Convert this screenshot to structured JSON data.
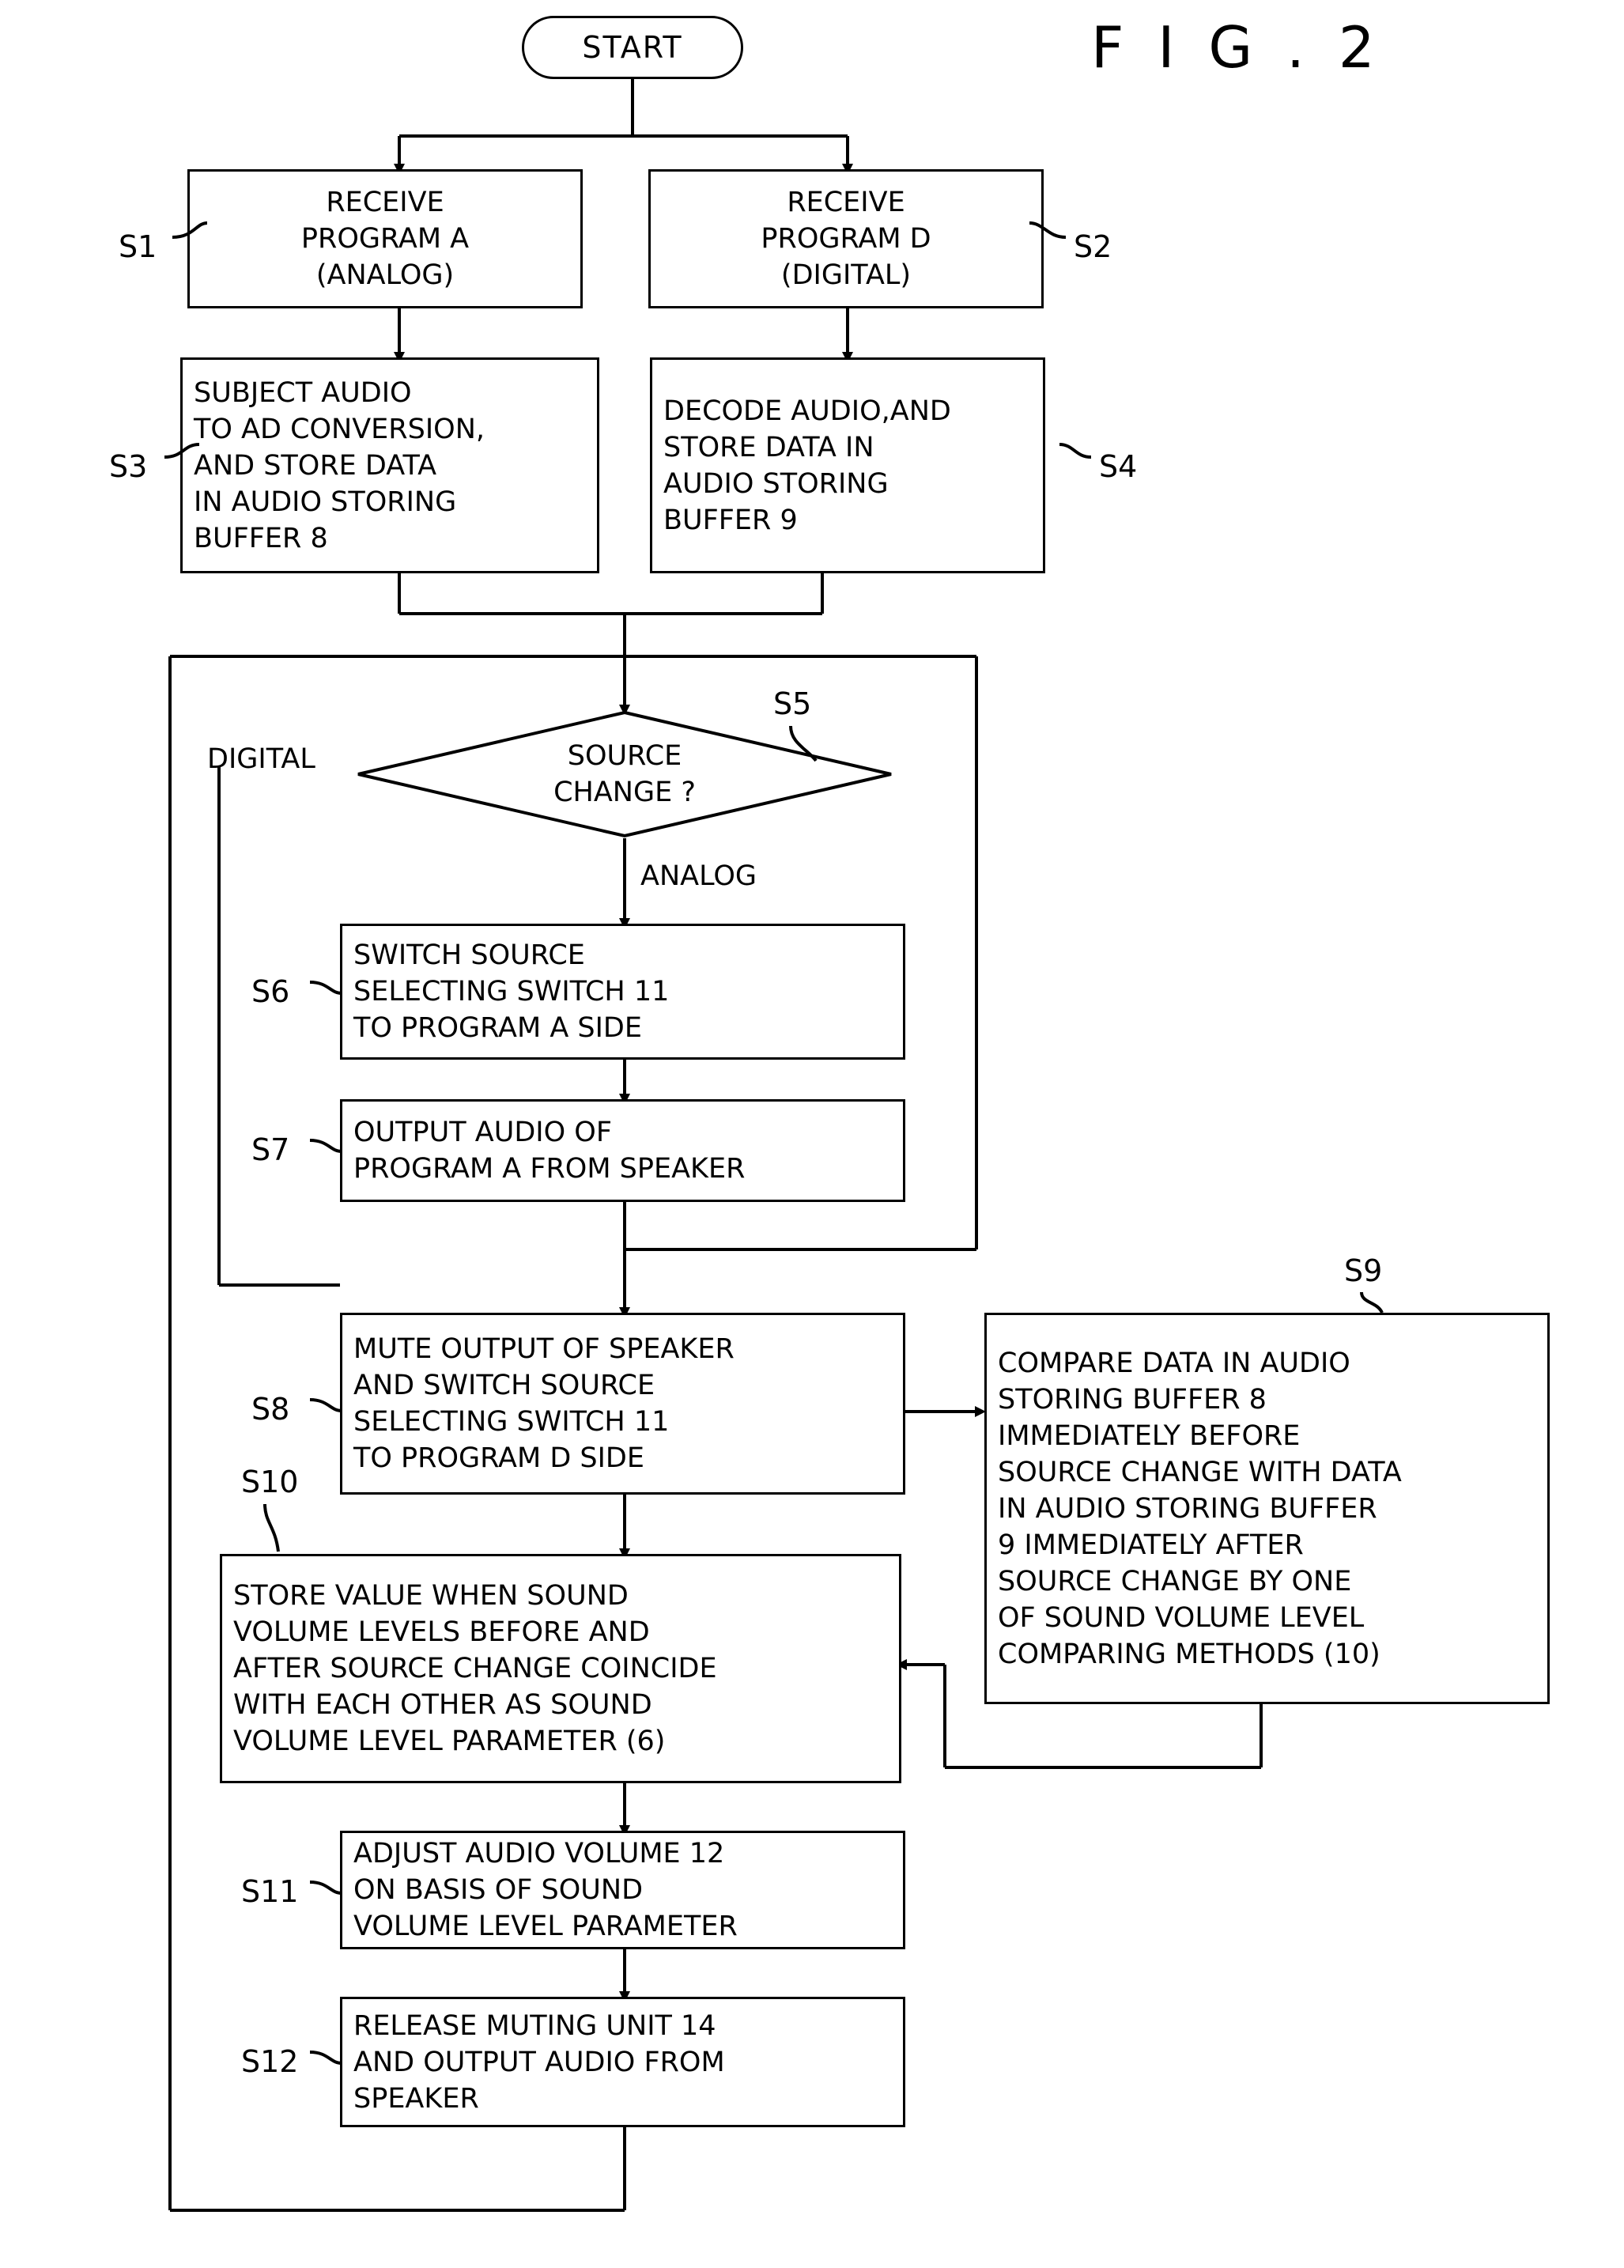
{
  "figure": {
    "title": "F I G . 2"
  },
  "nodes": {
    "start": {
      "label": "START"
    },
    "s1": {
      "tag": "S1",
      "lines": [
        "RECEIVE",
        "PROGRAM A",
        "(ANALOG)"
      ]
    },
    "s2": {
      "tag": "S2",
      "lines": [
        "RECEIVE",
        "PROGRAM D",
        "(DIGITAL)"
      ]
    },
    "s3": {
      "tag": "S3",
      "lines": [
        "SUBJECT AUDIO",
        "TO AD CONVERSION,",
        "AND STORE DATA",
        "IN AUDIO STORING",
        "BUFFER 8"
      ]
    },
    "s4": {
      "tag": "S4",
      "lines": [
        "DECODE AUDIO,AND",
        "STORE DATA IN",
        "AUDIO STORING",
        "BUFFER 9"
      ]
    },
    "s5": {
      "tag": "S5",
      "lines": [
        "SOURCE",
        "CHANGE ?"
      ],
      "branch_left": "DIGITAL",
      "branch_down": "ANALOG"
    },
    "s6": {
      "tag": "S6",
      "lines": [
        "SWITCH SOURCE",
        "SELECTING SWITCH 11",
        "TO PROGRAM A SIDE"
      ]
    },
    "s7": {
      "tag": "S7",
      "lines": [
        "OUTPUT AUDIO OF",
        "PROGRAM A FROM SPEAKER"
      ]
    },
    "s8": {
      "tag": "S8",
      "lines": [
        "MUTE OUTPUT OF SPEAKER",
        "AND SWITCH SOURCE",
        "SELECTING SWITCH 11",
        "TO PROGRAM D SIDE"
      ]
    },
    "s9": {
      "tag": "S9",
      "lines": [
        "COMPARE DATA IN AUDIO",
        "STORING BUFFER 8",
        "IMMEDIATELY BEFORE",
        "SOURCE CHANGE WITH DATA",
        "IN AUDIO STORING BUFFER",
        "9 IMMEDIATELY AFTER",
        "SOURCE CHANGE BY ONE",
        "OF SOUND VOLUME LEVEL",
        "COMPARING METHODS (10)"
      ]
    },
    "s10": {
      "tag": "S10",
      "lines": [
        "STORE VALUE WHEN SOUND",
        "VOLUME LEVELS BEFORE AND",
        "AFTER SOURCE CHANGE COINCIDE",
        "WITH EACH OTHER AS SOUND",
        "VOLUME LEVEL PARAMETER (6)"
      ]
    },
    "s11": {
      "tag": "S11",
      "lines": [
        "ADJUST AUDIO VOLUME 12",
        "ON BASIS OF SOUND",
        "VOLUME LEVEL PARAMETER"
      ]
    },
    "s12": {
      "tag": "S12",
      "lines": [
        "RELEASE MUTING UNIT 14",
        "AND OUTPUT AUDIO FROM",
        "SPEAKER"
      ]
    }
  }
}
